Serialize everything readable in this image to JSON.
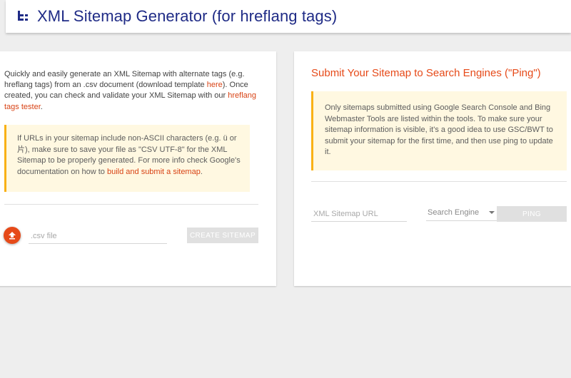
{
  "header": {
    "title": "XML Sitemap Generator (for hreflang tags)",
    "icon": "sitemap-icon"
  },
  "left_card": {
    "intro_part1": "Quickly and easily generate an XML Sitemap with alternate tags (e.g. hreflang tags) from an .csv document (download template ",
    "intro_link1": "here",
    "intro_part2": "). Once created, you can check and validate your XML Sitemap with our ",
    "intro_link2": "hreflang tags tester",
    "intro_part3": ".",
    "note_part1": "If URLs in your sitemap include non-ASCII characters (e.g. ü or 片), make sure to save your file as \"CSV UTF-8\" for the XML Sitemap to be properly generated. For more info check Google's documentation on how to ",
    "note_link": "build and submit a sitemap",
    "note_part2": ".",
    "file_placeholder": ".csv file",
    "create_button": "CREATE SITEMAP",
    "upload_icon": "upload-icon"
  },
  "right_card": {
    "title": "Submit Your Sitemap to Search Engines (\"Ping\")",
    "note": "Only sitemaps submitted using Google Search Console and Bing Webmaster Tools are listed within the tools. To make sure your sitemap information is visible, it's a good idea to use GSC/BWT to submit your sitemap for the first time, and then use ping to update it.",
    "url_placeholder": "XML Sitemap URL",
    "search_engine_label": "Search Engine",
    "ping_button": "PING"
  },
  "colors": {
    "title_blue": "#1f2b86",
    "accent_orange": "#e64a19",
    "note_bg": "#fff8e1",
    "note_border": "#f9b116"
  }
}
